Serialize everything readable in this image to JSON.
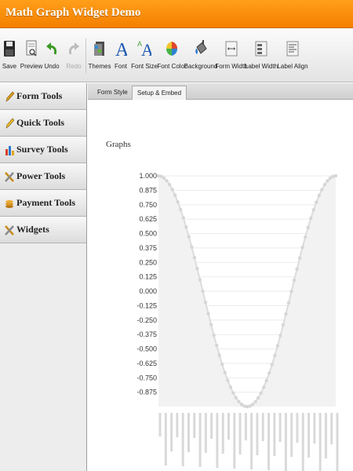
{
  "app": {
    "title": "Math Graph Widget Demo"
  },
  "toolbar": {
    "items": [
      {
        "label": "Save",
        "icon": "floppy-disk-icon",
        "enabled": true
      },
      {
        "label": "Preview",
        "icon": "preview-document-icon",
        "enabled": true
      },
      {
        "label": "Undo",
        "icon": "undo-arrow-icon",
        "enabled": true
      },
      {
        "label": "Redo",
        "icon": "redo-arrow-icon",
        "enabled": false
      },
      {
        "label": "Themes",
        "icon": "themes-icon",
        "enabled": true
      },
      {
        "label": "Font",
        "icon": "font-letter-icon",
        "enabled": true
      },
      {
        "label": "Font Size",
        "icon": "font-size-icon",
        "enabled": true
      },
      {
        "label": "Font Color",
        "icon": "color-palette-icon",
        "enabled": true
      },
      {
        "label": "Background",
        "icon": "paint-bucket-icon",
        "enabled": true
      },
      {
        "label": "Form Width",
        "icon": "form-width-icon",
        "enabled": true
      },
      {
        "label": "Label Width",
        "icon": "label-width-icon",
        "enabled": true
      },
      {
        "label": "Label Align",
        "icon": "label-align-icon",
        "enabled": true
      }
    ]
  },
  "sidebar": {
    "items": [
      {
        "label": "Form Tools",
        "icon": "pencil-icon"
      },
      {
        "label": "Quick Tools",
        "icon": "pencil-icon"
      },
      {
        "label": "Survey Tools",
        "icon": "bar-chart-icon"
      },
      {
        "label": "Power Tools",
        "icon": "tools-icon"
      },
      {
        "label": "Payment Tools",
        "icon": "coins-icon"
      },
      {
        "label": "Widgets",
        "icon": "tools-icon"
      }
    ]
  },
  "tabs": [
    {
      "label": "Form Style",
      "active": false
    },
    {
      "label": "Setup & Embed",
      "active": true
    }
  ],
  "main": {
    "section_label": "Graphs"
  },
  "colors": {
    "accent": "#f58a0b",
    "curve": "#dcdcdc",
    "fill": "#f2f2f2"
  },
  "chart_data": {
    "type": "area",
    "function": "cosine",
    "x_range": [
      0,
      6.28
    ],
    "x_samples": 65,
    "y_ticks": [
      "1.000",
      "0.875",
      "0.750",
      "0.625",
      "0.500",
      "0.375",
      "0.250",
      "0.125",
      "0.000",
      "-0.125",
      "-0.250",
      "-0.375",
      "-0.500",
      "-0.625",
      "-0.750",
      "-0.875"
    ],
    "ylim": [
      -1.0,
      1.0
    ],
    "grid": true,
    "legend": "none",
    "x_tick_labels_illegible": true
  }
}
